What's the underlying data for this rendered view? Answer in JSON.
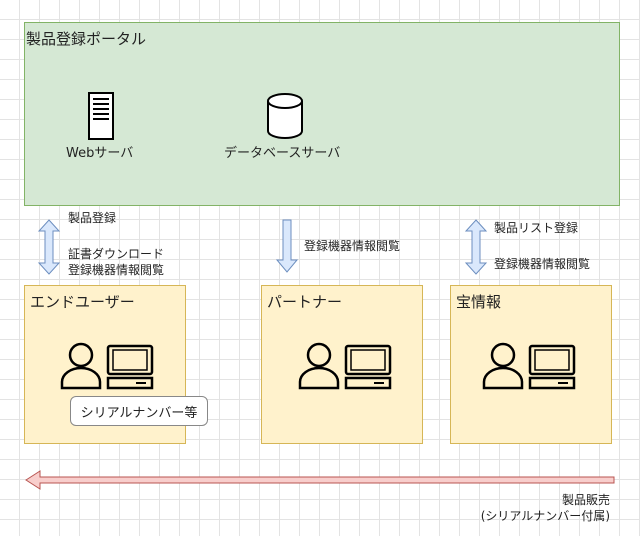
{
  "portal": {
    "title": "製品登録ポータル",
    "web_server_label": "Webサーバ",
    "db_server_label": "データベースサーバ"
  },
  "actors": {
    "end_user": {
      "title": "エンドユーザー",
      "tag": "シリアルナンバー等"
    },
    "partner": {
      "title": "パートナー"
    },
    "treasure_info": {
      "title": "宝情報"
    }
  },
  "flows": {
    "end_user_up": "製品登録",
    "end_user_down_1": "証書ダウンロード",
    "end_user_down_2": "登録機器情報閲覧",
    "partner_down": "登録機器情報閲覧",
    "treasure_up": "製品リスト登録",
    "treasure_down": "登録機器情報閲覧",
    "sales_line_1": "製品販売",
    "sales_line_2": "(シリアルナンバー付属)"
  },
  "colors": {
    "portal_fill": "#d5e8d4",
    "box_fill": "#fff2cc",
    "arrow_fill": "#dae8fc",
    "sales_arrow": "#f8cecc"
  }
}
